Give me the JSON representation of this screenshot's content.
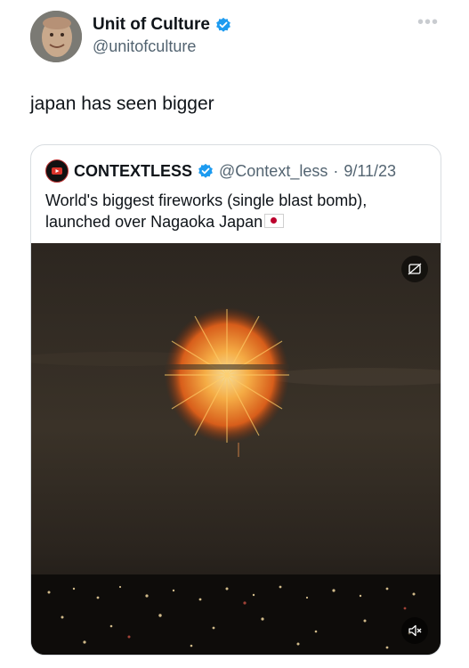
{
  "author": {
    "name": "Unit of Culture",
    "handle": "@unitofculture",
    "verified": true,
    "verified_color": "#1d9bf0"
  },
  "tweet": {
    "text": "japan has seen bigger"
  },
  "quoted": {
    "name": "CONTEXTLESS",
    "handle": "@Context_less",
    "separator": "·",
    "date": "9/11/23",
    "verified": true,
    "text": "World's biggest fireworks (single blast bomb), launched over Nagaoka Japan",
    "flag_icon": "japan-flag-icon",
    "media": {
      "type": "video",
      "description_icon": "fireworks-video",
      "muted": true
    }
  },
  "icons": {
    "more": "more-options-icon",
    "verified": "verified-badge-icon",
    "mute": "mute-icon",
    "gif_toggle": "hide-media-icon"
  }
}
